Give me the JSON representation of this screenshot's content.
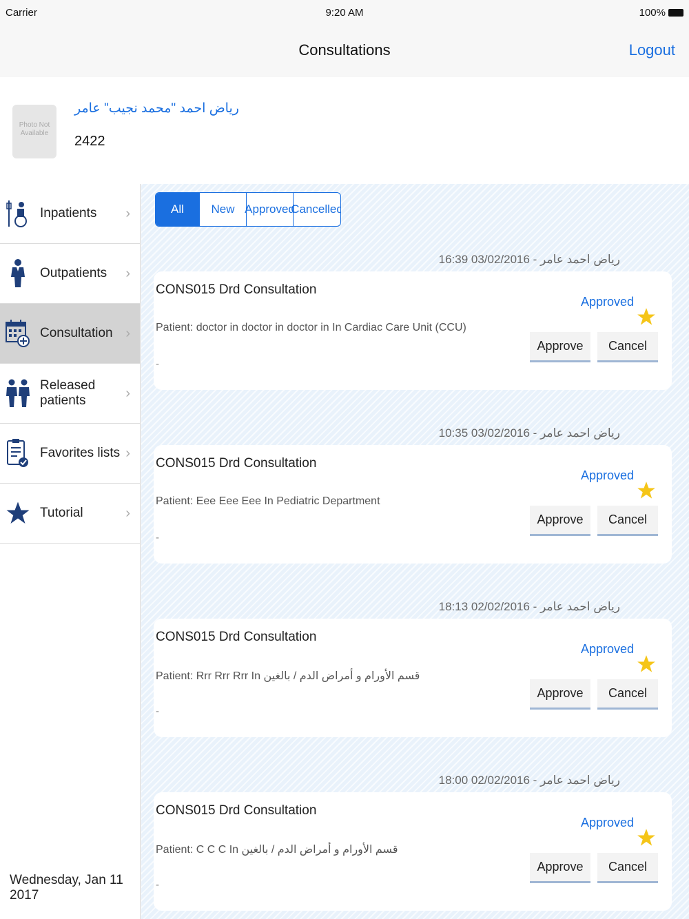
{
  "status_bar": {
    "carrier": "Carrier",
    "time": "9:20 AM",
    "battery": "100%"
  },
  "nav": {
    "title": "Consultations",
    "logout": "Logout"
  },
  "profile": {
    "photo_text": "Photo Not Available",
    "name": "رياض احمد \"محمد نجيب\" عامر",
    "id": "2422"
  },
  "sidebar": {
    "items": [
      {
        "label": "Inpatients",
        "icon": "inpatient-icon"
      },
      {
        "label": "Outpatients",
        "icon": "outpatient-icon"
      },
      {
        "label": "Consultation",
        "icon": "calendar-add-icon",
        "active": true
      },
      {
        "label": "Released patients",
        "icon": "released-patients-icon"
      },
      {
        "label": "Favorites lists",
        "icon": "checklist-icon"
      },
      {
        "label": "Tutorial",
        "icon": "star-icon"
      }
    ],
    "date": "Wednesday, Jan 11 2017"
  },
  "filters": {
    "tabs": [
      "All",
      "New",
      "Approved",
      "Cancelled"
    ],
    "selected": "All"
  },
  "consultations": [
    {
      "meta": "16:39 03/02/2016 - رياض احمد عامر",
      "title": "CONS015 Drd Consultation",
      "patient": "Patient: doctor in doctor in doctor in In Cardiac Care Unit (CCU)",
      "note": "-",
      "status": "Approved",
      "approve": "Approve",
      "cancel": "Cancel"
    },
    {
      "meta": "10:35 03/02/2016 - رياض احمد عامر",
      "title": "CONS015 Drd Consultation",
      "patient": "Patient: Eee Eee Eee In Pediatric Department",
      "note": "-",
      "status": "Approved",
      "approve": "Approve",
      "cancel": "Cancel"
    },
    {
      "meta": "18:13 02/02/2016 - رياض احمد عامر",
      "title": "CONS015 Drd Consultation",
      "patient": "Patient: Rrr Rrr Rrr In قسم الأورام و أمراض الدم / بالغين",
      "note": "-",
      "status": "Approved",
      "approve": "Approve",
      "cancel": "Cancel"
    },
    {
      "meta": "18:00 02/02/2016 - رياض احمد عامر",
      "title": "CONS015 Drd Consultation",
      "patient": "Patient: C C C In قسم الأورام و أمراض الدم / بالغين",
      "note": "-",
      "status": "Approved",
      "approve": "Approve",
      "cancel": "Cancel"
    }
  ],
  "colors": {
    "accent": "#1a6fe0",
    "star": "#f5c518",
    "icon_navy": "#1f3f7a",
    "active_row": "#d3d3d3"
  }
}
